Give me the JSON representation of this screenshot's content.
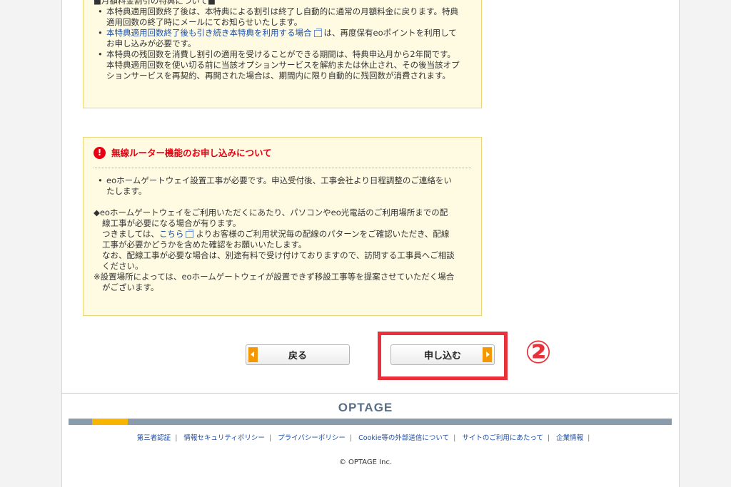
{
  "notice_box": {
    "partial_heading": "■月額料金割引の特典について■",
    "items": [
      {
        "lines": [
          "本特典適用回数終了後は、本特典による割引は終了し自動的に通常の月額料金に戻ります。特典",
          "適用回数の終了時にメールにてお知らせいたします。"
        ]
      },
      {
        "link": "本特典適用回数終了後も引き続き本特典を利用する場合",
        "after": "は、再度保有eoポイントを利用して",
        "line2": "お申し込みが必要です。"
      },
      {
        "lines": [
          "本特典の残回数を消費し割引の適用を受けることができる期間は、特典申込月から2年間です。",
          "本特典適用回数を使い切る前に当該オプションサービスを解約または休止され、その後当該オプ",
          "ションサービスを再契約、再開された場合は、期間内に限り自動的に残回数が消費されます。"
        ]
      }
    ]
  },
  "router_box": {
    "icon": "exclamation-icon",
    "title": "無線ルーター機能のお申し込みについて",
    "bullet_line1": "eoホームゲートウェイ設置工事が必要です。申込受付後、工事会社より日程調整のご連絡をい",
    "bullet_line2": "たします。",
    "para1_line1": "◆eoホームゲートウェイをご利用いただくにあたり、パソコンやeo光電話のご利用場所までの配",
    "para1_line2": "線工事が必要になる場合が有ります。",
    "para2_pre": "つきましては、",
    "para2_link": "こちら",
    "para2_post": "よりお客様のご利用状況毎の配線のパターンをご確認いただき、配線",
    "para2_line2": "工事が必要かどうかを含めた確認をお願いいたします。",
    "para3_line1": "なお、配線工事が必要な場合は、別途有料で受け付けておりますので、訪問する工事員へご相談",
    "para3_line2": "ください。",
    "note_line1": "※設置場所によっては、eoホームゲートウェイが設置できず移設工事等を提案させていただく場合",
    "note_line2": "がございます。"
  },
  "buttons": {
    "back_label": "戻る",
    "apply_label": "申し込む"
  },
  "annotation": {
    "step": "②",
    "color": "#e8313a"
  },
  "footer": {
    "logo": "OPTAGE",
    "links": [
      "第三者認証",
      "情報セキュリティポリシー",
      "プライバシーポリシー",
      "Cookie等の外部送信について",
      "サイトのご利用にあたって",
      "企業情報"
    ],
    "copyright": "© OPTAGE Inc."
  },
  "colors": {
    "accent_orange": "#f39800",
    "warning_red": "#e60012",
    "link_blue": "#1a4ea8",
    "notice_bg": "#fffbe3"
  }
}
